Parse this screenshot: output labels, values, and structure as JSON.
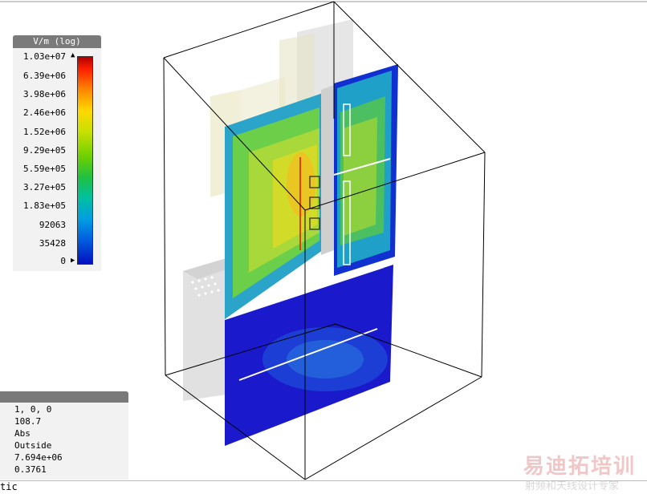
{
  "legend": {
    "title": "V/m (log)",
    "ticks": [
      "1.03e+07",
      "6.39e+06",
      "3.98e+06",
      "2.46e+06",
      "1.52e+06",
      "9.29e+05",
      "5.59e+05",
      "3.27e+05",
      "1.83e+05",
      "92063",
      "35428",
      "0"
    ],
    "colors": {
      "max": "#b00000",
      "mid": "#70d000",
      "min": "#0010c0"
    }
  },
  "probe": {
    "lines": [
      "1, 0, 0",
      "108.7",
      "Abs",
      "Outside",
      "7.694e+06",
      "0.3761"
    ]
  },
  "status": {
    "text": "tic"
  },
  "watermark": {
    "title": "易迪拓培训",
    "subtitle": "射频和天线设计专家"
  }
}
